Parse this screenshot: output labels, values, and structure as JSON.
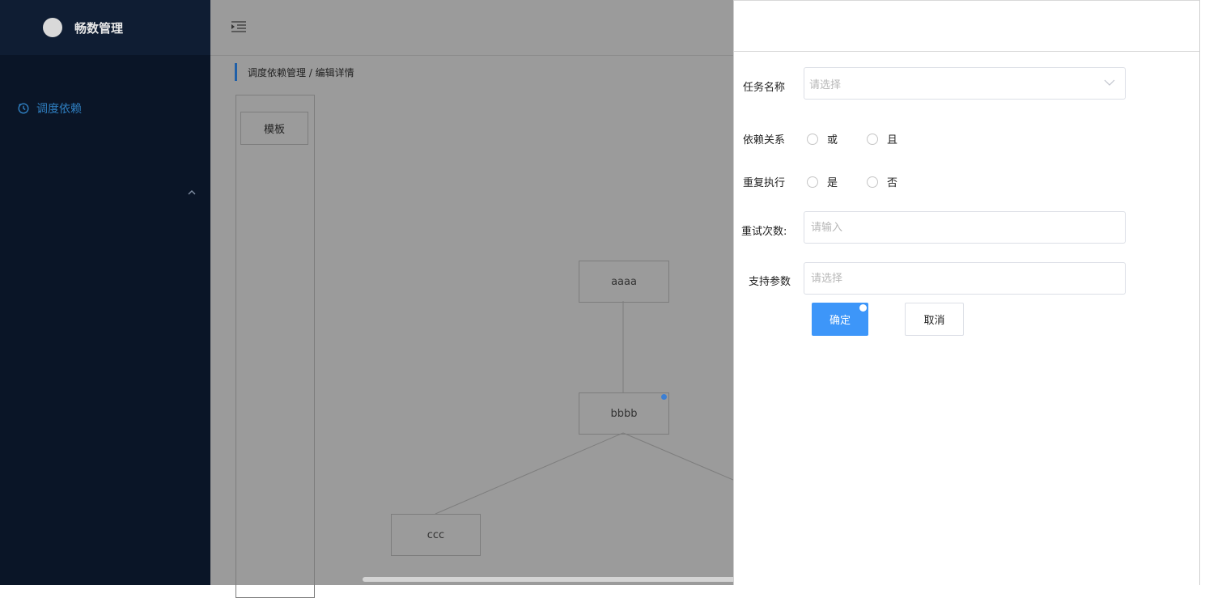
{
  "app": {
    "name": "畅数管理"
  },
  "sidebar": {
    "items": [
      {
        "label": "调度依赖",
        "icon": "clock-icon"
      }
    ]
  },
  "header": {
    "breadcrumb": "调度依赖管理 / 编辑详情"
  },
  "canvas": {
    "template_label": "模板",
    "nodes": [
      "aaaa",
      "bbbb",
      "ccc"
    ]
  },
  "form": {
    "task_name": {
      "label": "任务名称",
      "placeholder": "请选择"
    },
    "dependency": {
      "label": "依赖关系",
      "options": [
        "或",
        "且"
      ]
    },
    "repeat": {
      "label": "重复执行",
      "options": [
        "是",
        "否"
      ]
    },
    "retry": {
      "label": "重试次数:",
      "placeholder": "请输入"
    },
    "params": {
      "label": "支持参数",
      "placeholder": "请选择"
    },
    "confirm_label": "确定",
    "cancel_label": "取消"
  },
  "colors": {
    "primary": "#3d96f9",
    "sidebar_bg": "#0a1527",
    "accent_text": "#2f7fc1"
  }
}
